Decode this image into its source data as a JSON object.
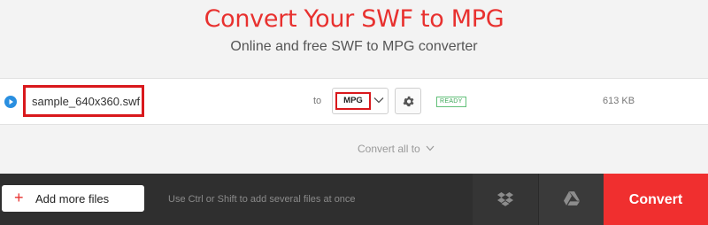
{
  "header": {
    "title": "Convert Your SWF to MPG",
    "subtitle": "Online and free SWF to MPG converter"
  },
  "file": {
    "name": "sample_640x360.swf",
    "to_label": "to",
    "format": "MPG",
    "status": "READY",
    "size": "613 KB"
  },
  "convert_all": {
    "label": "Convert all to"
  },
  "bottom_bar": {
    "add_files_label": "Add more files",
    "hint": "Use Ctrl or Shift to add several files at once",
    "convert_label": "Convert"
  },
  "colors": {
    "brand_red": "#e8312f",
    "highlight_box": "#d9181c",
    "ready_green": "#3ea85a",
    "play_blue": "#2a8fe0"
  },
  "icons": [
    "play-icon",
    "chevron-down-icon",
    "gear-icon",
    "plus-icon",
    "dropbox-icon",
    "google-drive-icon"
  ]
}
